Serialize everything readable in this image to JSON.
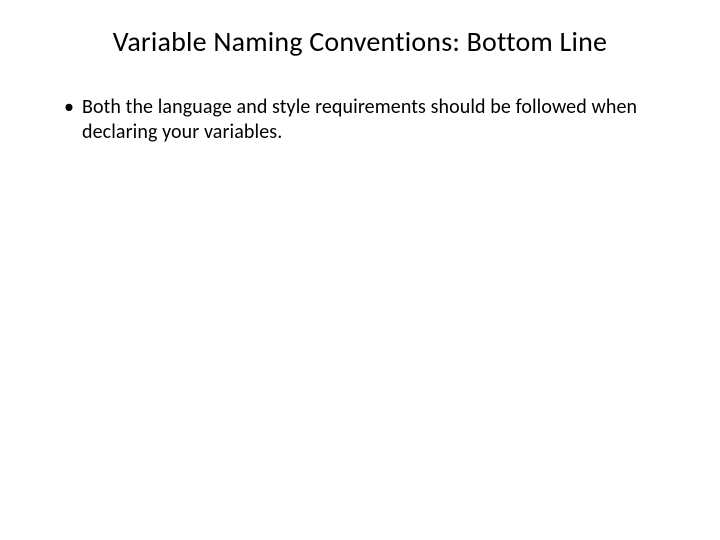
{
  "slide": {
    "title": "Variable Naming Conventions: Bottom Line",
    "bullets": [
      "Both the language and style requirements should be followed when declaring your variables."
    ]
  }
}
